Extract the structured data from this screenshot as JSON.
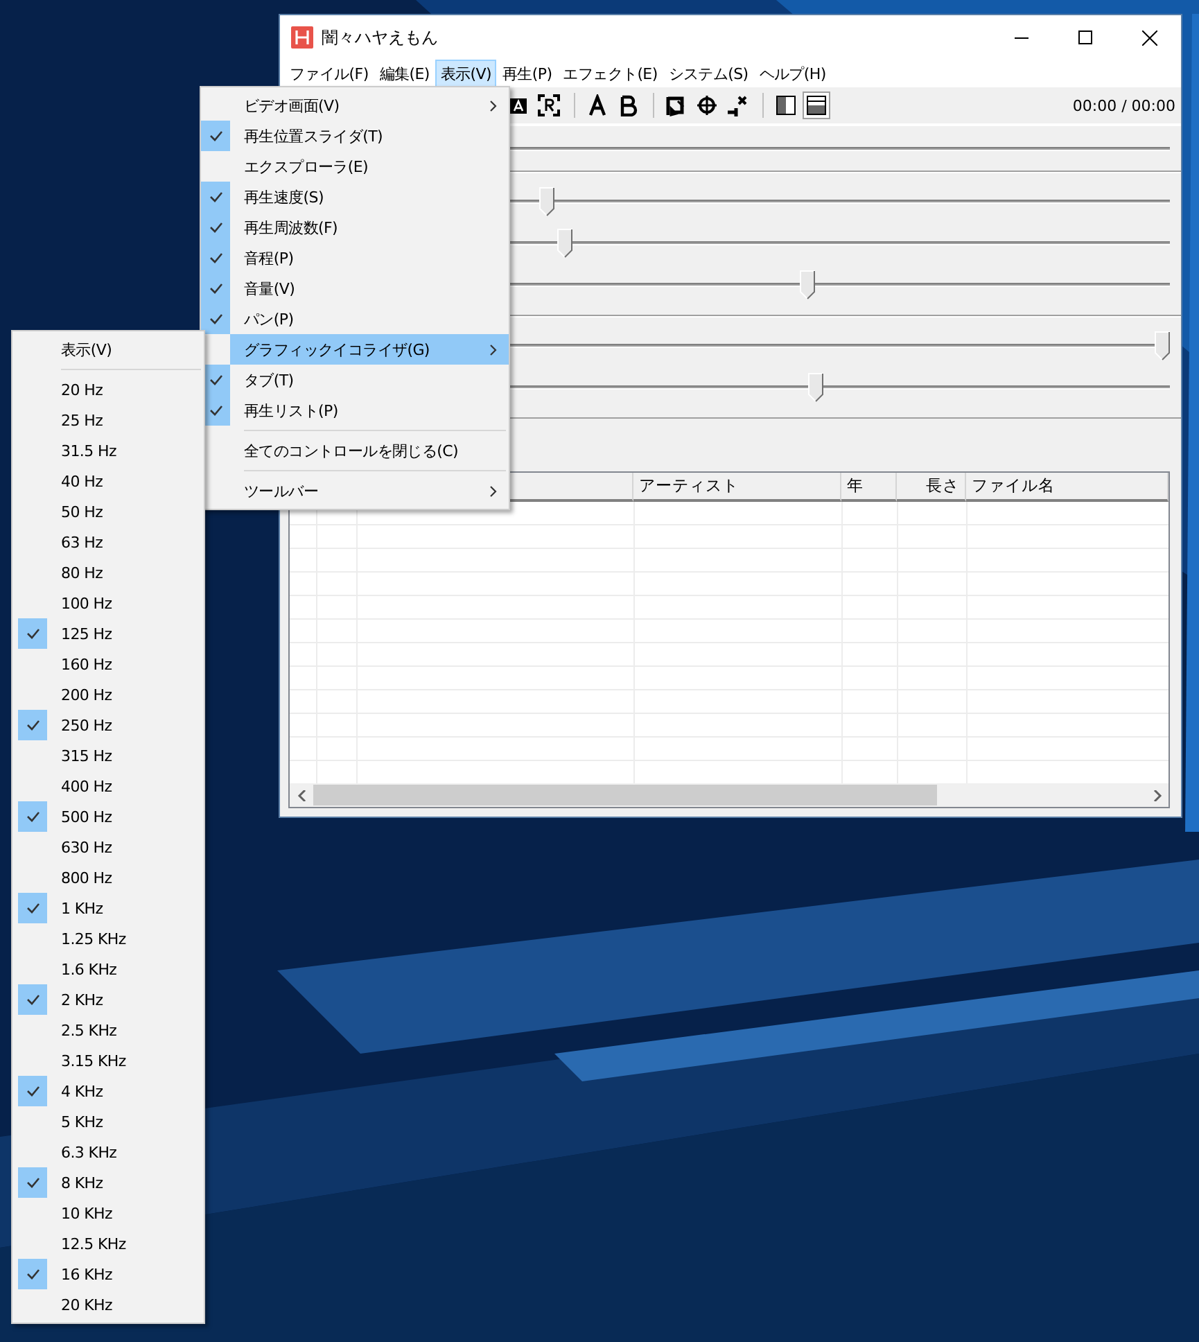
{
  "window": {
    "title": "闇々ハヤえもん"
  },
  "menu_bar": [
    {
      "label": "ファイル(F)",
      "selected": false
    },
    {
      "label": "編集(E)",
      "selected": false
    },
    {
      "label": "表示(V)",
      "selected": true
    },
    {
      "label": "再生(P)",
      "selected": false
    },
    {
      "label": "エフェクト(E)",
      "selected": false
    },
    {
      "label": "システム(S)",
      "selected": false
    },
    {
      "label": "ヘルプ(H)",
      "selected": false
    }
  ],
  "toolbar": {
    "time": "00:00 / 00:00"
  },
  "slider_groups": [
    {
      "sliders": [
        {
          "level": 0.29
        },
        {
          "level": 0.31
        },
        {
          "level": 0.59
        }
      ]
    },
    {
      "sliders": [
        {
          "level": 1.0
        },
        {
          "level": 0.6
        }
      ]
    }
  ],
  "playlist": {
    "columns": [
      {
        "label": "アーティスト"
      },
      {
        "label": "年"
      },
      {
        "label": "長さ"
      },
      {
        "label": "ファイル名"
      }
    ]
  },
  "view_menu": {
    "items": [
      {
        "kind": "item",
        "label": "ビデオ画面(V)",
        "checked": false,
        "submenu": true,
        "selected": false
      },
      {
        "kind": "item",
        "label": "再生位置スライダ(T)",
        "checked": true,
        "submenu": false,
        "selected": false
      },
      {
        "kind": "item",
        "label": "エクスプローラ(E)",
        "checked": false,
        "submenu": false,
        "selected": false
      },
      {
        "kind": "item",
        "label": "再生速度(S)",
        "checked": true,
        "submenu": false,
        "selected": false
      },
      {
        "kind": "item",
        "label": "再生周波数(F)",
        "checked": true,
        "submenu": false,
        "selected": false
      },
      {
        "kind": "item",
        "label": "音程(P)",
        "checked": true,
        "submenu": false,
        "selected": false
      },
      {
        "kind": "item",
        "label": "音量(V)",
        "checked": true,
        "submenu": false,
        "selected": false
      },
      {
        "kind": "item",
        "label": "パン(P)",
        "checked": true,
        "submenu": false,
        "selected": false
      },
      {
        "kind": "item",
        "label": "グラフィックイコライザ(G)",
        "checked": false,
        "submenu": true,
        "selected": true
      },
      {
        "kind": "item",
        "label": "タブ(T)",
        "checked": true,
        "submenu": false,
        "selected": false
      },
      {
        "kind": "item",
        "label": "再生リスト(P)",
        "checked": true,
        "submenu": false,
        "selected": false
      },
      {
        "kind": "separator"
      },
      {
        "kind": "item",
        "label": "全てのコントロールを閉じる(C)",
        "checked": false,
        "submenu": false,
        "selected": false
      },
      {
        "kind": "separator"
      },
      {
        "kind": "item",
        "label": "ツールバー",
        "checked": false,
        "submenu": true,
        "selected": false
      }
    ]
  },
  "eq_menu": {
    "items": [
      {
        "kind": "item",
        "label": "表示(V)",
        "checked": false
      },
      {
        "kind": "separator"
      },
      {
        "kind": "item",
        "label": "20 Hz",
        "checked": false
      },
      {
        "kind": "item",
        "label": "25 Hz",
        "checked": false
      },
      {
        "kind": "item",
        "label": "31.5 Hz",
        "checked": false
      },
      {
        "kind": "item",
        "label": "40 Hz",
        "checked": false
      },
      {
        "kind": "item",
        "label": "50 Hz",
        "checked": false
      },
      {
        "kind": "item",
        "label": "63 Hz",
        "checked": false
      },
      {
        "kind": "item",
        "label": "80 Hz",
        "checked": false
      },
      {
        "kind": "item",
        "label": "100 Hz",
        "checked": false
      },
      {
        "kind": "item",
        "label": "125 Hz",
        "checked": true
      },
      {
        "kind": "item",
        "label": "160 Hz",
        "checked": false
      },
      {
        "kind": "item",
        "label": "200 Hz",
        "checked": false
      },
      {
        "kind": "item",
        "label": "250 Hz",
        "checked": true
      },
      {
        "kind": "item",
        "label": "315 Hz",
        "checked": false
      },
      {
        "kind": "item",
        "label": "400 Hz",
        "checked": false
      },
      {
        "kind": "item",
        "label": "500 Hz",
        "checked": true
      },
      {
        "kind": "item",
        "label": "630 Hz",
        "checked": false
      },
      {
        "kind": "item",
        "label": "800 Hz",
        "checked": false
      },
      {
        "kind": "item",
        "label": "1 KHz",
        "checked": true
      },
      {
        "kind": "item",
        "label": "1.25 KHz",
        "checked": false
      },
      {
        "kind": "item",
        "label": "1.6 KHz",
        "checked": false
      },
      {
        "kind": "item",
        "label": "2 KHz",
        "checked": true
      },
      {
        "kind": "item",
        "label": "2.5 KHz",
        "checked": false
      },
      {
        "kind": "item",
        "label": "3.15 KHz",
        "checked": false
      },
      {
        "kind": "item",
        "label": "4 KHz",
        "checked": true
      },
      {
        "kind": "item",
        "label": "5 KHz",
        "checked": false
      },
      {
        "kind": "item",
        "label": "6.3 KHz",
        "checked": false
      },
      {
        "kind": "item",
        "label": "8 KHz",
        "checked": true
      },
      {
        "kind": "item",
        "label": "10 KHz",
        "checked": false
      },
      {
        "kind": "item",
        "label": "12.5 KHz",
        "checked": false
      },
      {
        "kind": "item",
        "label": "16 KHz",
        "checked": true
      },
      {
        "kind": "item",
        "label": "20 KHz",
        "checked": false
      }
    ]
  }
}
